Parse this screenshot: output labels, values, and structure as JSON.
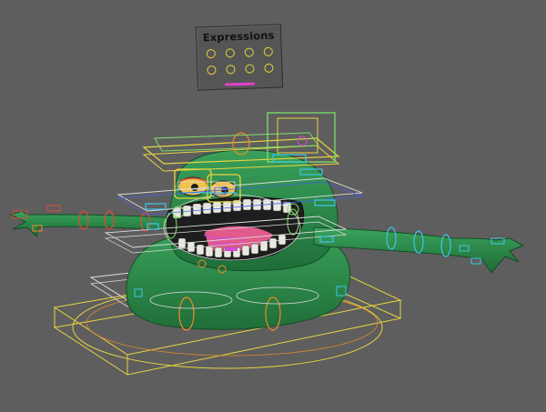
{
  "viewport": {
    "background": "#5e5e5e"
  },
  "expressions_panel": {
    "title": "Expressions",
    "controls": [
      {
        "icon": "circle-control"
      },
      {
        "icon": "circle-control"
      },
      {
        "icon": "circle-control"
      },
      {
        "icon": "circle-control"
      },
      {
        "icon": "circle-control"
      },
      {
        "icon": "circle-control"
      },
      {
        "icon": "circle-control"
      },
      {
        "icon": "circle-control"
      }
    ],
    "control_color": "#e3d23a",
    "slider_color": "#e042c8"
  },
  "character": {
    "body_color": "#2f8a4c",
    "body_shadow": "#1f5f33",
    "teeth_color": "#e9e9df",
    "tongue_color": "#e15a8c",
    "eye_color": "#f1c24a"
  },
  "rig_colors": {
    "yellow_ctrl": "#e6d440",
    "green_ctrl": "#7ee06a",
    "white_ctrl": "#dcdcdc",
    "cyan_ctrl": "#41c6e6",
    "blue_ctrl": "#4a5ee8",
    "red_ctrl": "#e04a3a",
    "orange_ctrl": "#f08a2a",
    "magenta_ctrl": "#d24ad6"
  }
}
